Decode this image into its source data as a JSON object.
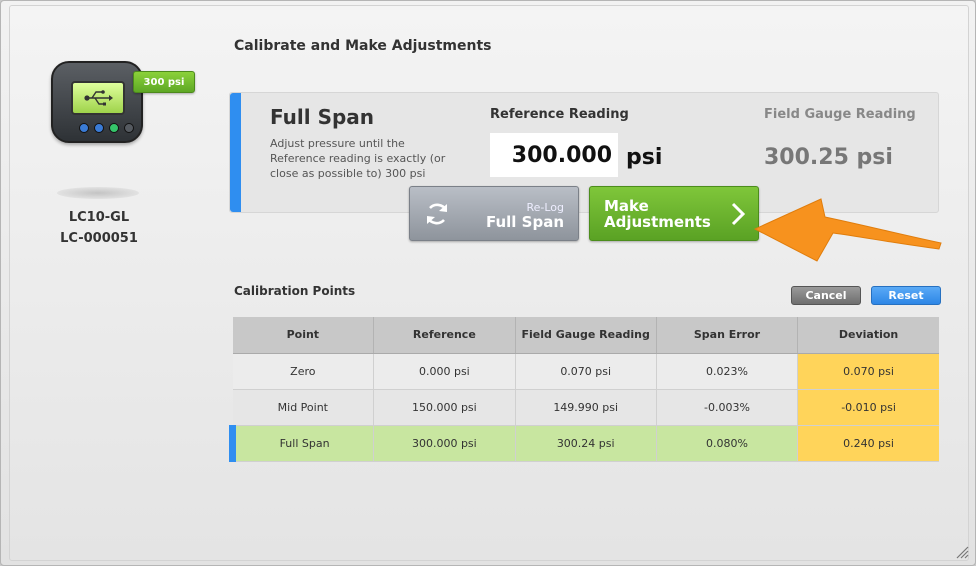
{
  "device": {
    "badge": "300 psi",
    "model": "LC10-GL",
    "serial": "LC-000051",
    "screen_icon": "usb-icon",
    "dot_colors": [
      "#3a7bd5",
      "#3a7bd5",
      "#35c46a",
      "#555a60"
    ]
  },
  "page": {
    "title": "Calibrate and Make Adjustments"
  },
  "span_card": {
    "title": "Full Span",
    "description": "Adjust pressure until the Reference reading is exactly (or close as possible to) 300 psi",
    "reference_label": "Reference Reading",
    "reference_value": "300.000",
    "reference_unit": "psi",
    "field_label": "Field Gauge Reading",
    "field_value": "300.25 psi"
  },
  "buttons": {
    "relog_small": "Re-Log",
    "relog_big": "Full Span",
    "make_line1": "Make",
    "make_line2": "Adjustments",
    "cancel": "Cancel",
    "reset": "Reset"
  },
  "calibration": {
    "title": "Calibration Points",
    "headers": [
      "Point",
      "Reference",
      "Field Gauge Reading",
      "Span Error",
      "Deviation"
    ],
    "rows": [
      [
        "Zero",
        "0.000 psi",
        "0.070 psi",
        "0.023%",
        "0.070 psi"
      ],
      [
        "Mid Point",
        "150.000 psi",
        "149.990 psi",
        "-0.003%",
        "-0.010 psi"
      ],
      [
        "Full Span",
        "300.000 psi",
        "300.24 psi",
        "0.080%",
        "0.240 psi"
      ]
    ]
  },
  "colors": {
    "accent_blue": "#2f8ef0",
    "green": "#6bb52e",
    "deviation_yellow": "#ffd45a",
    "active_row": "#c8e6a0",
    "callout_orange": "#f7921e"
  }
}
